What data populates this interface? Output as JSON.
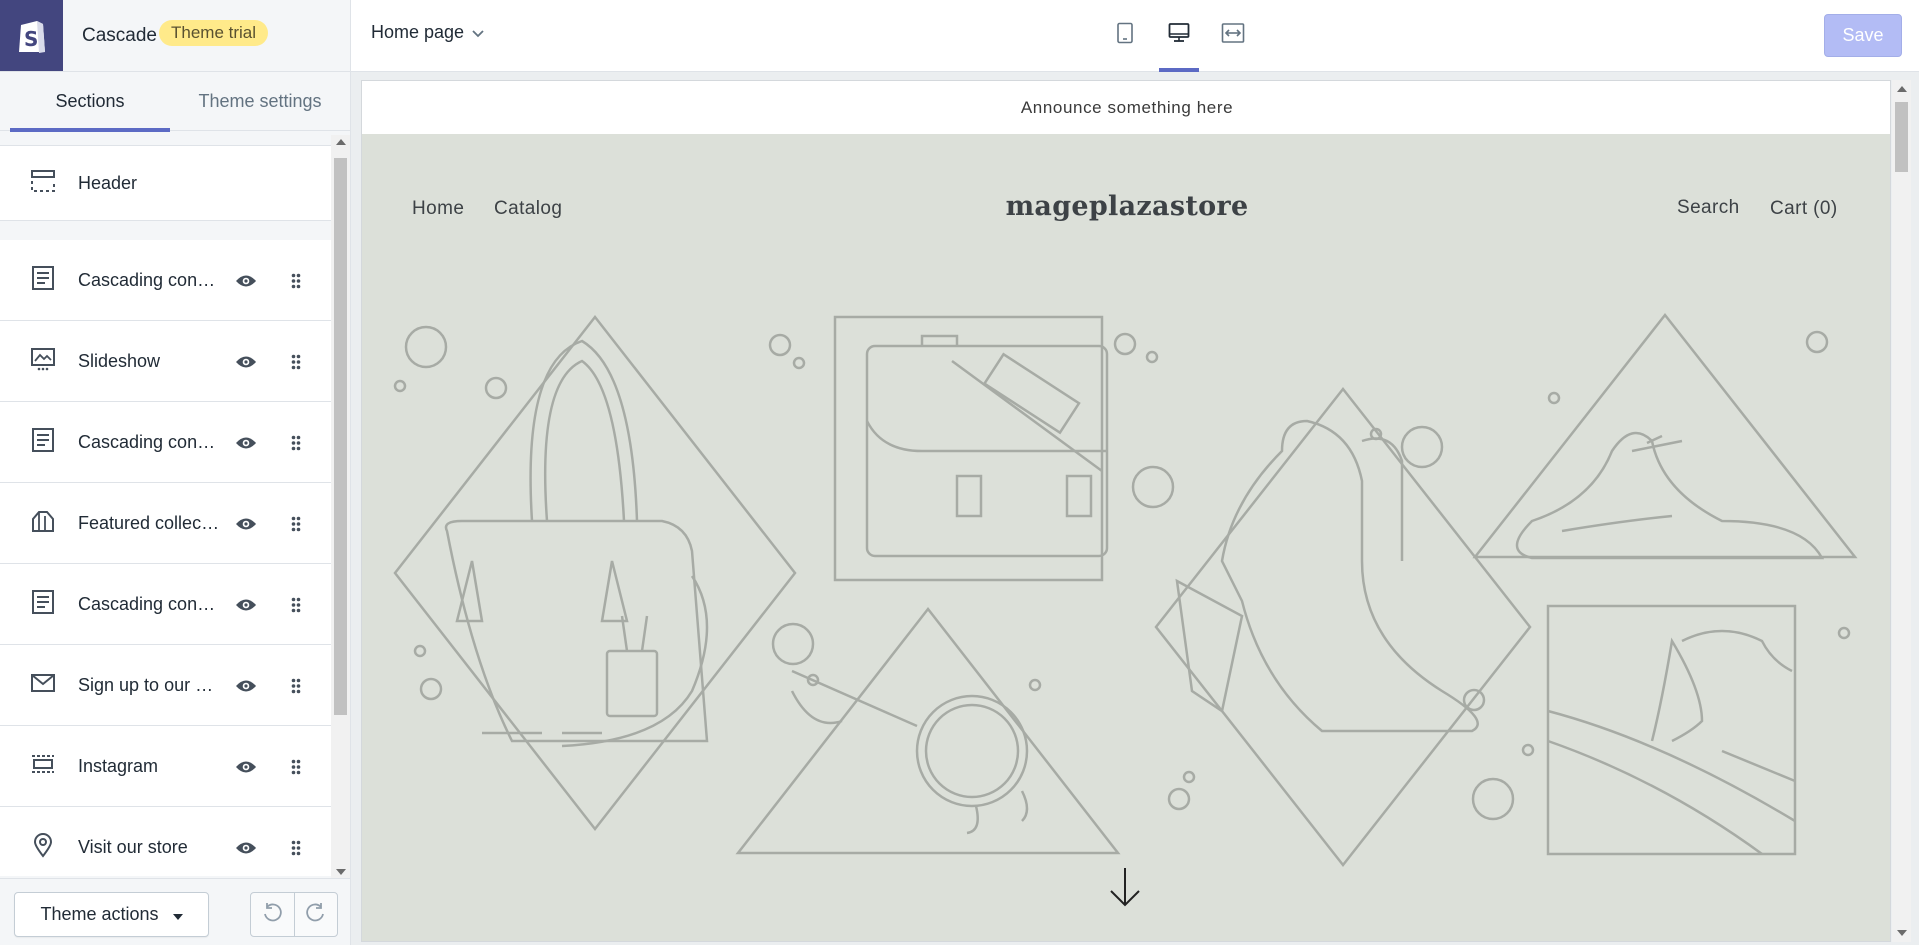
{
  "app": {
    "theme_name": "Cascade",
    "trial_badge": "Theme trial",
    "page_selector": "Home page",
    "save_label": "Save",
    "accent_color": "#5c6ac4",
    "logo_bg_color": "#43467f"
  },
  "devices": [
    {
      "name": "mobile",
      "icon": "mobile-icon",
      "active": false
    },
    {
      "name": "desktop",
      "icon": "desktop-icon",
      "active": true
    },
    {
      "name": "full-width",
      "icon": "fullscreen-icon",
      "active": false
    }
  ],
  "sidebar": {
    "tabs": {
      "sections": "Sections",
      "theme_settings": "Theme settings"
    },
    "header_item": {
      "label": "Header",
      "icon": "header-icon"
    },
    "sections": [
      {
        "label": "Cascading conte...",
        "icon": "text-block-icon"
      },
      {
        "label": "Slideshow",
        "icon": "slideshow-icon"
      },
      {
        "label": "Cascading conte...",
        "icon": "text-block-icon"
      },
      {
        "label": "Featured collecti...",
        "icon": "collection-icon"
      },
      {
        "label": "Cascading conte...",
        "icon": "text-block-icon"
      },
      {
        "label": "Sign up to our n...",
        "icon": "mail-icon"
      },
      {
        "label": "Instagram",
        "icon": "instagram-icon"
      },
      {
        "label": "Visit our store",
        "icon": "location-icon"
      }
    ],
    "theme_actions_label": "Theme actions"
  },
  "preview": {
    "announcement": "Announce something here",
    "store_name": "mageplazastore",
    "nav": {
      "home": "Home",
      "catalog": "Catalog",
      "search": "Search",
      "cart": "Cart (0)"
    },
    "hero_bg_color": "#dce0d9"
  }
}
